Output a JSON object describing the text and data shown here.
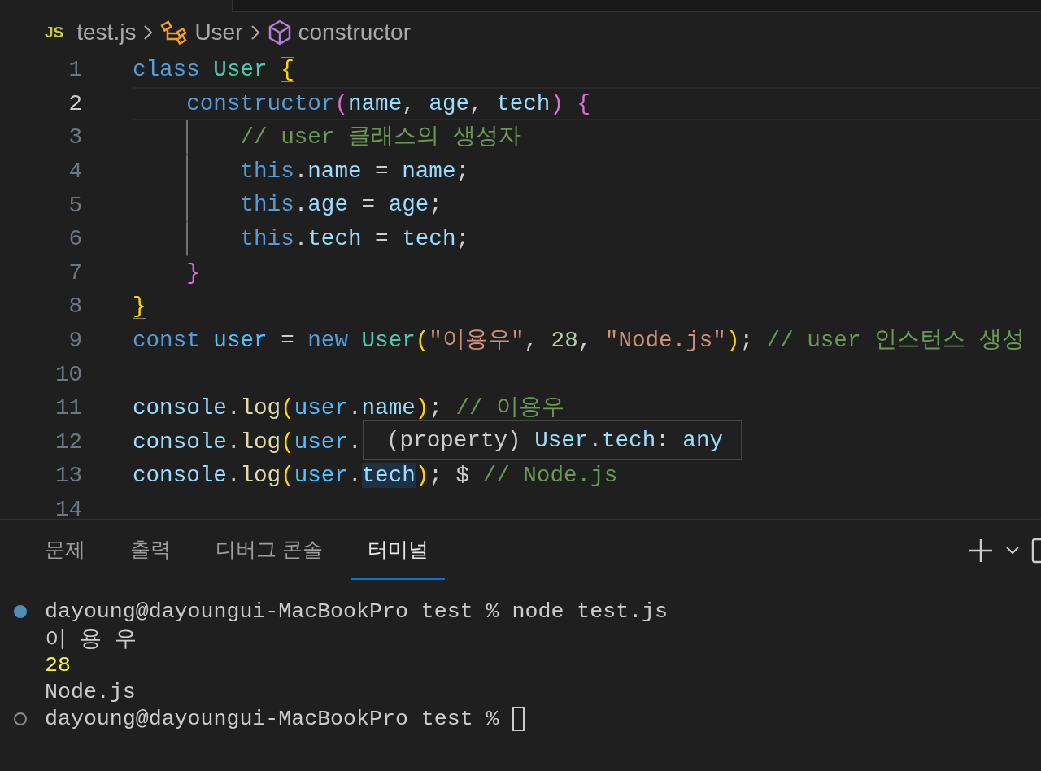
{
  "breadcrumb": {
    "file_icon": "JS",
    "items": [
      {
        "kind": "file",
        "label": "test.js"
      },
      {
        "kind": "class",
        "label": "User"
      },
      {
        "kind": "method",
        "label": "constructor"
      }
    ]
  },
  "editor": {
    "lines": [
      {
        "number": "1",
        "active": false,
        "guide": false,
        "tokens": [
          {
            "kind": "keyword",
            "text": "class "
          },
          {
            "kind": "type",
            "text": "User "
          },
          {
            "kind": "bracket-match",
            "text": "{"
          }
        ]
      },
      {
        "number": "2",
        "active": true,
        "guide": false,
        "tokens": [
          {
            "kind": "keyword",
            "text": "    constructor"
          },
          {
            "kind": "paren2",
            "text": "("
          },
          {
            "kind": "variable",
            "text": "name"
          },
          {
            "kind": "plain",
            "text": ", "
          },
          {
            "kind": "variable",
            "text": "age"
          },
          {
            "kind": "plain",
            "text": ", "
          },
          {
            "kind": "variable",
            "text": "tech"
          },
          {
            "kind": "paren2",
            "text": ") {"
          }
        ]
      },
      {
        "number": "3",
        "active": false,
        "guide": true,
        "tokens": [
          {
            "kind": "comment",
            "text": "        // user 클래스의 생성자"
          }
        ]
      },
      {
        "number": "4",
        "active": false,
        "guide": true,
        "tokens": [
          {
            "kind": "keyword",
            "text": "        this"
          },
          {
            "kind": "plain",
            "text": "."
          },
          {
            "kind": "variable",
            "text": "name"
          },
          {
            "kind": "plain",
            "text": " = "
          },
          {
            "kind": "variable",
            "text": "name"
          },
          {
            "kind": "plain",
            "text": ";"
          }
        ]
      },
      {
        "number": "5",
        "active": false,
        "guide": true,
        "tokens": [
          {
            "kind": "keyword",
            "text": "        this"
          },
          {
            "kind": "plain",
            "text": "."
          },
          {
            "kind": "variable",
            "text": "age"
          },
          {
            "kind": "plain",
            "text": " = "
          },
          {
            "kind": "variable",
            "text": "age"
          },
          {
            "kind": "plain",
            "text": ";"
          }
        ]
      },
      {
        "number": "6",
        "active": false,
        "guide": true,
        "tokens": [
          {
            "kind": "keyword",
            "text": "        this"
          },
          {
            "kind": "plain",
            "text": "."
          },
          {
            "kind": "variable",
            "text": "tech"
          },
          {
            "kind": "plain",
            "text": " = "
          },
          {
            "kind": "variable",
            "text": "tech"
          },
          {
            "kind": "plain",
            "text": ";"
          }
        ]
      },
      {
        "number": "7",
        "active": false,
        "guide": false,
        "tokens": [
          {
            "kind": "paren2",
            "text": "    }"
          }
        ]
      },
      {
        "number": "8",
        "active": false,
        "guide": false,
        "tokens": [
          {
            "kind": "bracket-match",
            "text": "}"
          }
        ]
      },
      {
        "number": "9",
        "active": false,
        "guide": false,
        "tokens": [
          {
            "kind": "keyword",
            "text": "const "
          },
          {
            "kind": "constant",
            "text": "user"
          },
          {
            "kind": "plain",
            "text": " = "
          },
          {
            "kind": "keyword",
            "text": "new "
          },
          {
            "kind": "type",
            "text": "User"
          },
          {
            "kind": "paren1",
            "text": "("
          },
          {
            "kind": "string",
            "text": "\"이용우\""
          },
          {
            "kind": "plain",
            "text": ", "
          },
          {
            "kind": "number",
            "text": "28"
          },
          {
            "kind": "plain",
            "text": ", "
          },
          {
            "kind": "string",
            "text": "\"Node.js\""
          },
          {
            "kind": "paren1",
            "text": ")"
          },
          {
            "kind": "plain",
            "text": "; "
          },
          {
            "kind": "comment",
            "text": "// user 인스턴스 생성"
          }
        ]
      },
      {
        "number": "10",
        "active": false
      },
      {
        "number": "11",
        "active": false,
        "guide": false,
        "tokens": [
          {
            "kind": "variable",
            "text": "console"
          },
          {
            "kind": "plain",
            "text": "."
          },
          {
            "kind": "function",
            "text": "log"
          },
          {
            "kind": "paren1",
            "text": "("
          },
          {
            "kind": "constant",
            "text": "user"
          },
          {
            "kind": "plain",
            "text": "."
          },
          {
            "kind": "variable",
            "text": "name"
          },
          {
            "kind": "paren1",
            "text": ")"
          },
          {
            "kind": "plain",
            "text": "; "
          },
          {
            "kind": "comment",
            "text": "// 이용우"
          }
        ]
      },
      {
        "number": "12",
        "active": false,
        "guide": false,
        "tokens": [
          {
            "kind": "variable",
            "text": "console"
          },
          {
            "kind": "plain",
            "text": "."
          },
          {
            "kind": "function",
            "text": "log"
          },
          {
            "kind": "paren1",
            "text": "("
          },
          {
            "kind": "constant",
            "text": "user"
          },
          {
            "kind": "plain",
            "text": "."
          }
        ]
      },
      {
        "number": "13",
        "active": false,
        "guide": false,
        "tokens": [
          {
            "kind": "variable",
            "text": "console"
          },
          {
            "kind": "plain",
            "text": "."
          },
          {
            "kind": "function",
            "text": "log"
          },
          {
            "kind": "paren1",
            "text": "("
          },
          {
            "kind": "constant",
            "text": "user"
          },
          {
            "kind": "plain",
            "text": "."
          },
          {
            "kind": "hover",
            "text": "tech"
          },
          {
            "kind": "paren1",
            "text": ")"
          },
          {
            "kind": "plain",
            "text": "; $ "
          },
          {
            "kind": "comment",
            "text": "// Node.js"
          }
        ]
      },
      {
        "number": "14",
        "active": false
      }
    ],
    "hover_tooltip": [
      {
        "kind": "plain",
        "text": "(property) "
      },
      {
        "kind": "variable",
        "text": "User"
      },
      {
        "kind": "plain",
        "text": "."
      },
      {
        "kind": "variable",
        "text": "tech"
      },
      {
        "kind": "plain",
        "text": ": "
      },
      {
        "kind": "variable",
        "text": "any"
      }
    ]
  },
  "panel": {
    "tabs": [
      {
        "label": "문제",
        "selected": false
      },
      {
        "label": "출력",
        "selected": false
      },
      {
        "label": "디버그 콘솔",
        "selected": false
      },
      {
        "label": "터미널",
        "selected": true
      }
    ]
  },
  "terminal": {
    "lines": [
      {
        "kind": "command",
        "done": true,
        "text": "dayoung@dayoungui-MacBookPro test % node test.js"
      },
      {
        "kind": "output",
        "text": "이 용 우"
      },
      {
        "kind": "number",
        "text": "28"
      },
      {
        "kind": "output",
        "text": "Node.js"
      },
      {
        "kind": "prompt",
        "done": false,
        "text": "dayoung@dayoungui-MacBookPro test %"
      }
    ]
  }
}
